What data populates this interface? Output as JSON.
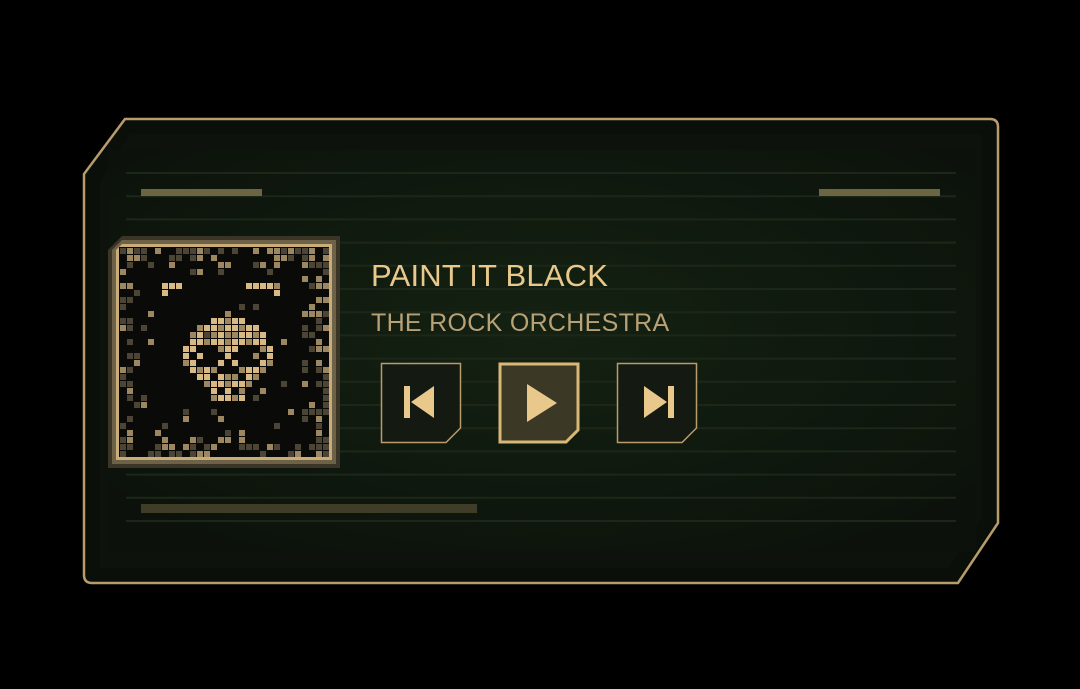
{
  "player": {
    "track_title": "PAINT IT BLACK",
    "artist": "THE ROCK ORCHESTRA",
    "progress_fraction": 0.56
  },
  "controls": [
    {
      "name": "previous",
      "icon": "skip-back-icon"
    },
    {
      "name": "play",
      "icon": "play-icon"
    },
    {
      "name": "next",
      "icon": "skip-forward-icon"
    }
  ],
  "colors": {
    "background": "#000000",
    "panel": "#111a0f",
    "border": "#b79c6c",
    "accent": "#e9c98b",
    "text_secondary": "#b9a176",
    "deco": "#6b6641"
  }
}
